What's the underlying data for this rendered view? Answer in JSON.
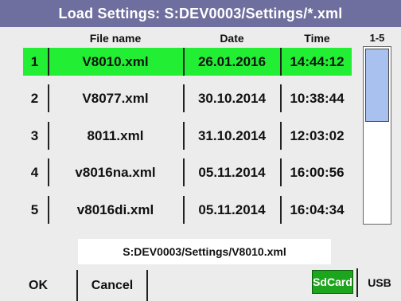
{
  "window": {
    "title": "Load Settings:  S:DEV0003/Settings/*.xml"
  },
  "columns": {
    "file_name": "File name",
    "date": "Date",
    "time": "Time"
  },
  "scroll": {
    "range_label": "1-5",
    "visible_fraction": 0.42
  },
  "rows": [
    {
      "index": "1",
      "file": "V8010.xml",
      "date": "26.01.2016",
      "time": "14:44:12",
      "selected": true
    },
    {
      "index": "2",
      "file": "V8077.xml",
      "date": "30.10.2014",
      "time": "10:38:44",
      "selected": false
    },
    {
      "index": "3",
      "file": "8011.xml",
      "date": "31.10.2014",
      "time": "12:03:02",
      "selected": false
    },
    {
      "index": "4",
      "file": "v8016na.xml",
      "date": "05.11.2014",
      "time": "16:00:56",
      "selected": false
    },
    {
      "index": "5",
      "file": "v8016di.xml",
      "date": "05.11.2014",
      "time": "16:04:34",
      "selected": false
    }
  ],
  "selected_path": "S:DEV0003/Settings/V8010.xml",
  "buttons": {
    "ok": "OK",
    "cancel": "Cancel",
    "sdcard": "SdCard",
    "usb": "USB"
  },
  "colors": {
    "title_bar": "#6f6f9f",
    "selection": "#22ee33",
    "sdcard_active": "#1ea51e",
    "scroll_thumb": "#a9c1ef"
  }
}
